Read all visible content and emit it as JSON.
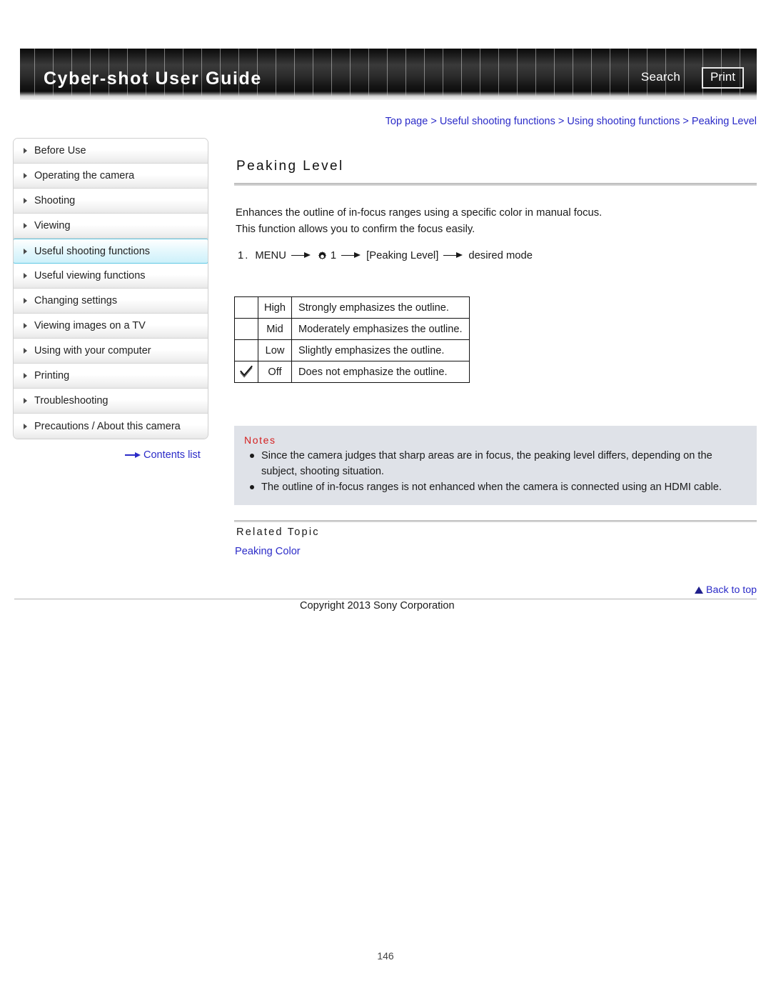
{
  "header": {
    "site_title": "Cyber-shot User Guide",
    "search_label": "Search",
    "print_label": "Print"
  },
  "breadcrumb": {
    "full": "Top page > Useful shooting functions > Using shooting functions > Peaking Level",
    "items": [
      "Top page",
      "Useful shooting functions",
      "Using shooting functions",
      "Peaking Level"
    ]
  },
  "sidebar": {
    "items": [
      {
        "label": "Before Use",
        "active": false
      },
      {
        "label": "Operating the camera",
        "active": false
      },
      {
        "label": "Shooting",
        "active": false
      },
      {
        "label": "Viewing",
        "active": false
      },
      {
        "label": "Useful shooting functions",
        "active": true
      },
      {
        "label": "Useful viewing functions",
        "active": false
      },
      {
        "label": "Changing settings",
        "active": false
      },
      {
        "label": "Viewing images on a TV",
        "active": false
      },
      {
        "label": "Using with your computer",
        "active": false
      },
      {
        "label": "Printing",
        "active": false
      },
      {
        "label": "Troubleshooting",
        "active": false
      },
      {
        "label": "Precautions / About this camera",
        "active": false
      }
    ],
    "contents_list_label": "Contents list"
  },
  "main": {
    "title": "Peaking Level",
    "paragraph_1": "Enhances the outline of in-focus ranges using a specific color in manual focus.",
    "paragraph_2": "This function allows you to confirm the focus easily.",
    "step": {
      "number": "1.",
      "menu_label": "MENU",
      "gear_number": "1",
      "bracket_label": "[Peaking Level]",
      "final_label": "desired mode"
    },
    "options_table": {
      "rows": [
        {
          "checked": false,
          "name": "High",
          "description": "Strongly emphasizes the outline."
        },
        {
          "checked": false,
          "name": "Mid",
          "description": "Moderately emphasizes the outline."
        },
        {
          "checked": false,
          "name": "Low",
          "description": "Slightly emphasizes the outline."
        },
        {
          "checked": true,
          "name": "Off",
          "description": "Does not emphasize the outline."
        }
      ]
    },
    "notes": {
      "title": "Notes",
      "items": [
        "Since the camera judges that sharp areas are in focus, the peaking level differs, depending on the subject, shooting situation.",
        "The outline of in-focus ranges is not enhanced when the camera is connected using an HDMI cable."
      ]
    },
    "related_topic": {
      "heading": "Related Topic",
      "links": [
        "Peaking Color"
      ]
    }
  },
  "footer": {
    "back_to_top": "Back to top",
    "copyright": "Copyright 2013 Sony Corporation",
    "page_number": "146"
  },
  "colors": {
    "link": "#2b2bc8",
    "notes_title": "#d42020",
    "notes_background": "#dfe2e8",
    "sidebar_active_border": "#5fc8e4",
    "header_dark": "#141414"
  }
}
